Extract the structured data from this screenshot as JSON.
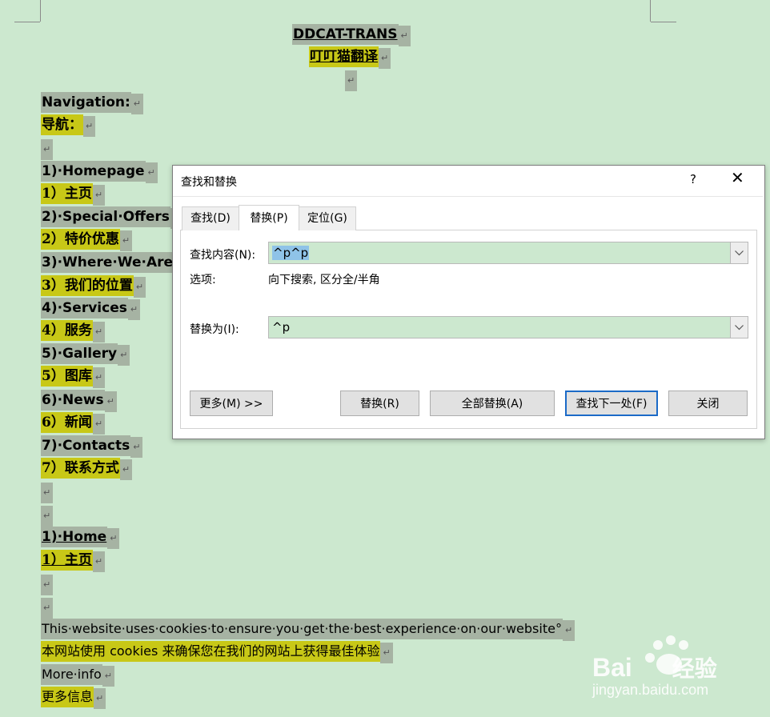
{
  "document": {
    "title_en": "DDCAT-TRANS",
    "title_zh": "叮叮猫翻译",
    "nav_heading_en": "Navigation:",
    "nav_heading_zh": "导航：",
    "nav_items": [
      {
        "en": "1)·Homepage",
        "zh": "1）主页"
      },
      {
        "en": "2)·Special·Offers",
        "zh": "2）特价优惠"
      },
      {
        "en": "3)·Where·We·Are",
        "zh": "3）我们的位置"
      },
      {
        "en": "4)·Services",
        "zh": "4）服务"
      },
      {
        "en": "5)·Gallery",
        "zh": "5）图库"
      },
      {
        "en": "6)·News",
        "zh": "6）新闻"
      },
      {
        "en": "7)·Contacts",
        "zh": "7）联系方式"
      }
    ],
    "home_en": "1)·Home",
    "home_zh": "1）主页",
    "cookie_en": "This·website·uses·cookies·to·ensure·you·get·the·best·experience·on·our·website°",
    "cookie_zh": "本网站使用 cookies 来确保您在我们的网站上获得最佳体验",
    "more_en": "More·info",
    "more_zh": "更多信息",
    "paragraph_mark": "↵"
  },
  "dialog": {
    "title": "查找和替换",
    "help_label": "?",
    "close_label": "✕",
    "tabs": [
      {
        "label": "查找(D)"
      },
      {
        "label": "替换(P)"
      },
      {
        "label": "定位(G)"
      }
    ],
    "find_label": "查找内容(N):",
    "find_value": "^p^p",
    "options_label": "选项:",
    "options_value": "向下搜索, 区分全/半角",
    "replace_label": "替换为(I):",
    "replace_value": "^p",
    "buttons": {
      "more": "更多(M) >>",
      "replace": "替换(R)",
      "replace_all": "全部替换(A)",
      "find_next": "查找下一处(F)",
      "close": "关闭"
    }
  },
  "watermark": {
    "brand": "Bai",
    "brand_suffix": "经验",
    "url": "jingyan.baidu.com"
  },
  "colors": {
    "page_bg": "#cce8cf",
    "highlight_gray": "#a6b3a3",
    "highlight_yellow": "#c8c817",
    "accent_blue": "#1b6ac7"
  }
}
